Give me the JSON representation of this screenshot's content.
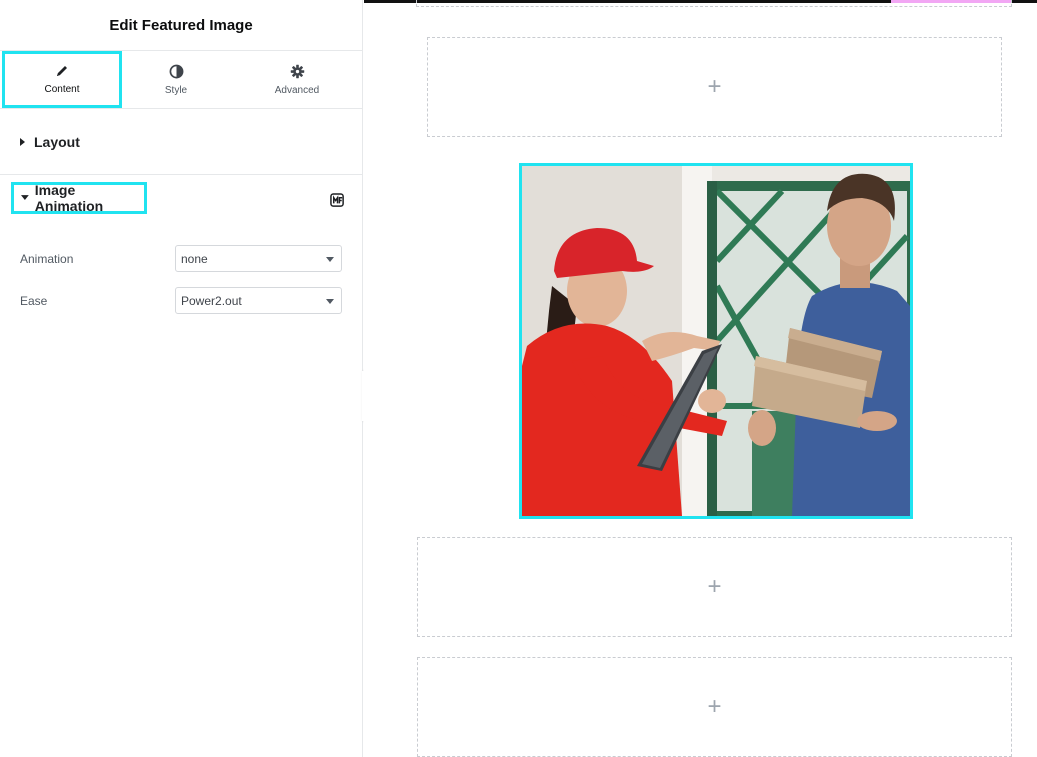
{
  "panel": {
    "title": "Edit Featured Image",
    "tabs": [
      {
        "label": "Content",
        "icon": "pencil-icon"
      },
      {
        "label": "Style",
        "icon": "half-circle-icon"
      },
      {
        "label": "Advanced",
        "icon": "gear-icon"
      }
    ],
    "sections": {
      "layout": {
        "label": "Layout",
        "expanded": false
      },
      "image_animation": {
        "label": "Image Animation",
        "expanded": true,
        "badge_icon": "motion-fx-icon"
      }
    },
    "controls": {
      "animation": {
        "label": "Animation",
        "value": "none"
      },
      "ease": {
        "label": "Ease",
        "value": "Power2.out"
      }
    },
    "collapse_icon": "chevron-left-icon"
  },
  "canvas": {
    "add_section_symbol": "+",
    "image_alt": "Courier in red uniform delivering packages to a man at a door",
    "colors": {
      "selection_outline": "#20e3f0",
      "accent_bar": "#f2a7f4"
    }
  }
}
